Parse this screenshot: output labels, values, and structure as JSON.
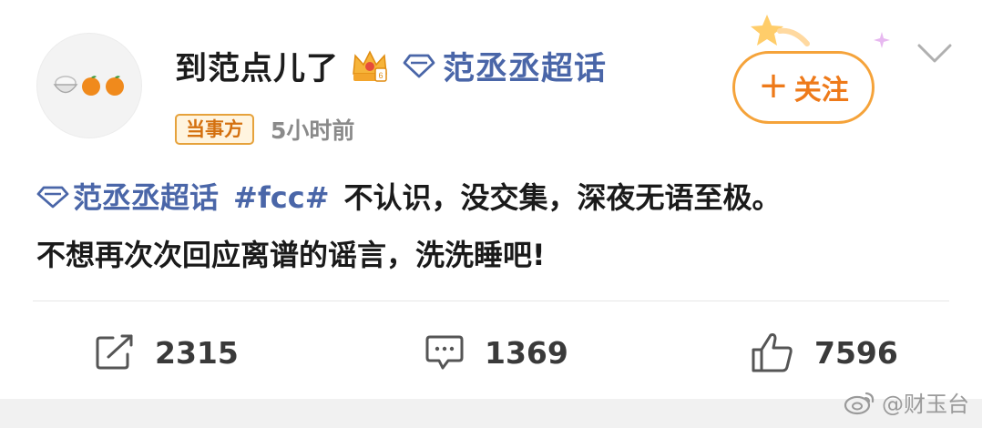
{
  "post": {
    "username": "到范点儿了",
    "supertopic_name": "范丞丞超话",
    "badge": "当事方",
    "time": "5小时前",
    "follow_label": "关注",
    "follow_plus": "+",
    "content": {
      "topic_link": "范丞丞超话",
      "hashtag": "#fcc#",
      "line1_text": "不认识，没交集，深夜无语至极。",
      "line2_text": "不想再次次回应离谱的谣言，洗洗睡吧!"
    }
  },
  "actions": {
    "repost_count": "2315",
    "comment_count": "1369",
    "like_count": "7596"
  },
  "watermark": {
    "text": "@财玉台"
  },
  "colors": {
    "link_blue": "#4a66a8",
    "follow_orange": "#ee7a1a",
    "badge_orange": "#d4700f"
  },
  "icons": [
    "rice-bowl-icon",
    "orange-icon",
    "crown-icon",
    "diamond-icon",
    "star-icon",
    "sparkle-icon",
    "chevron-down-icon",
    "repost-icon",
    "comment-icon",
    "like-icon",
    "weibo-logo-icon"
  ]
}
